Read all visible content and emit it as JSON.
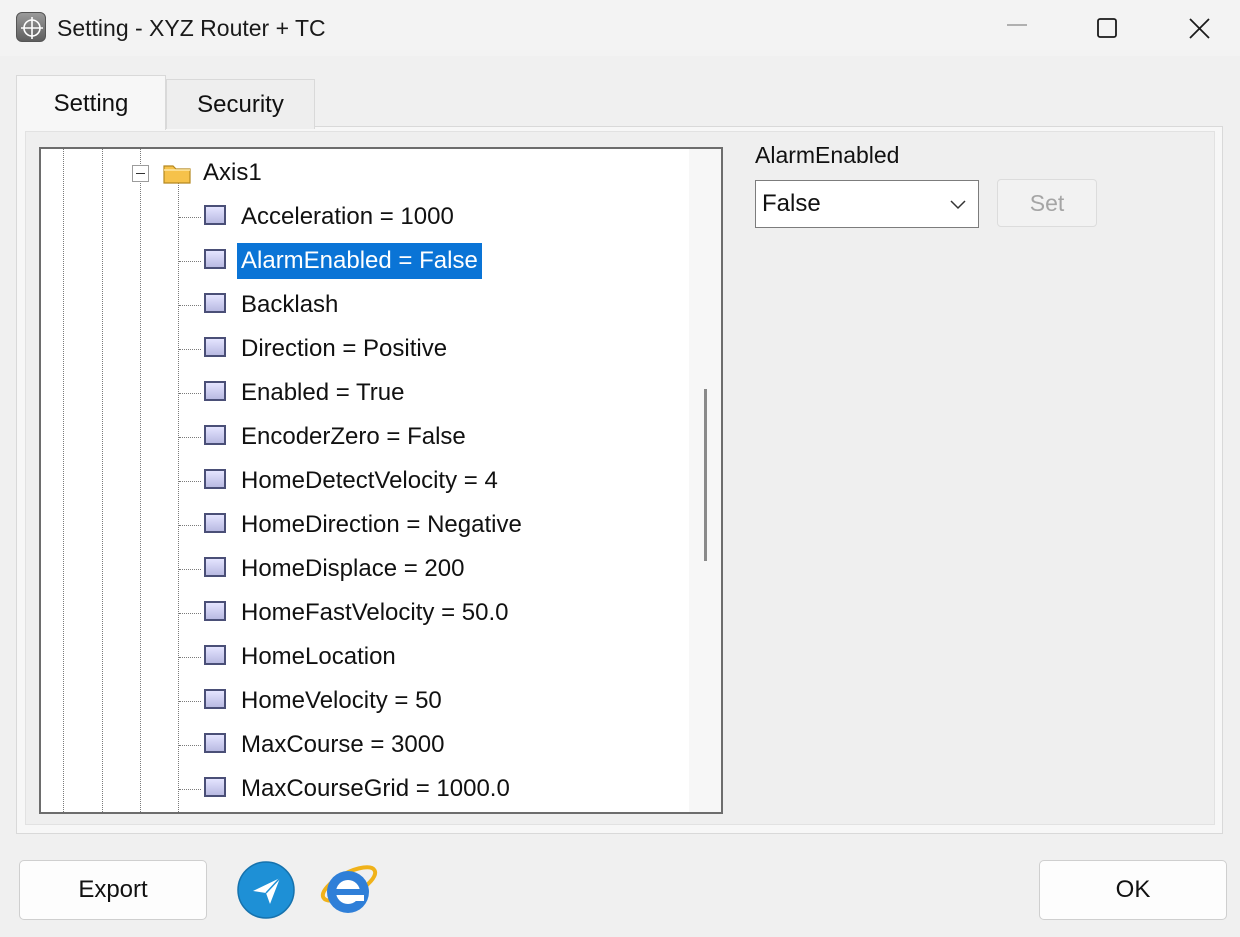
{
  "window": {
    "title": "Setting - XYZ Router + TC",
    "controls": {
      "minimize": "minimize-icon",
      "maximize": "maximize-icon",
      "close": "close-icon"
    }
  },
  "tabs": [
    {
      "label": "Setting",
      "active": true
    },
    {
      "label": "Security",
      "active": false
    }
  ],
  "tree": {
    "parent": {
      "label": "Axis1",
      "expanded": true
    },
    "items": [
      {
        "label": "Acceleration = 1000",
        "selected": false
      },
      {
        "label": "AlarmEnabled = False",
        "selected": true
      },
      {
        "label": "Backlash",
        "selected": false
      },
      {
        "label": "Direction = Positive",
        "selected": false
      },
      {
        "label": "Enabled = True",
        "selected": false
      },
      {
        "label": "EncoderZero = False",
        "selected": false
      },
      {
        "label": "HomeDetectVelocity = 4",
        "selected": false
      },
      {
        "label": "HomeDirection = Negative",
        "selected": false
      },
      {
        "label": "HomeDisplace = 200",
        "selected": false
      },
      {
        "label": "HomeFastVelocity = 50.0",
        "selected": false
      },
      {
        "label": "HomeLocation",
        "selected": false
      },
      {
        "label": "HomeVelocity = 50",
        "selected": false
      },
      {
        "label": "MaxCourse = 3000",
        "selected": false
      },
      {
        "label": "MaxCourseGrid = 1000.0",
        "selected": false
      }
    ]
  },
  "editor": {
    "property_name": "AlarmEnabled",
    "selected_value": "False",
    "set_label": "Set"
  },
  "footer": {
    "export_label": "Export",
    "ok_label": "OK"
  },
  "colors": {
    "selection": "#0a74d6",
    "send_icon": "#1e90d6"
  }
}
